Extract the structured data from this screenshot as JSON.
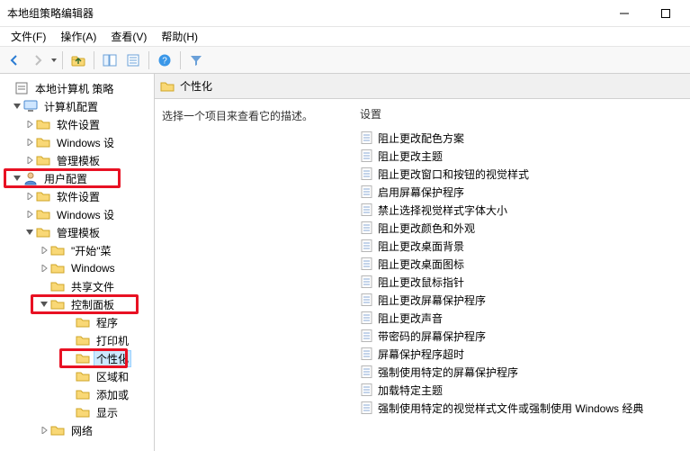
{
  "window": {
    "title": "本地组策略编辑器"
  },
  "menu": {
    "file": "文件(F)",
    "action": "操作(A)",
    "view": "查看(V)",
    "help": "帮助(H)"
  },
  "tree": {
    "root": "本地计算机 策略",
    "computer_cfg": "计算机配置",
    "comp_sw": "软件设置",
    "comp_win": "Windows 设",
    "comp_adm": "管理模板",
    "user_cfg": "用户配置",
    "user_sw": "软件设置",
    "user_win": "Windows 设",
    "user_adm": "管理模板",
    "start_menu": "\"开始\"菜",
    "windows": "Windows",
    "shared_folders": "共享文件",
    "control_panel": "控制面板",
    "programs": "程序",
    "printers": "打印机",
    "personalization": "个性化",
    "regional": "区域和",
    "add_remove": "添加或",
    "display": "显示",
    "network": "网络"
  },
  "content": {
    "header": "个性化",
    "desc": "选择一个项目来查看它的描述。",
    "settings_label": "设置",
    "items": [
      "阻止更改配色方案",
      "阻止更改主题",
      "阻止更改窗口和按钮的视觉样式",
      "启用屏幕保护程序",
      "禁止选择视觉样式字体大小",
      "阻止更改颜色和外观",
      "阻止更改桌面背景",
      "阻止更改桌面图标",
      "阻止更改鼠标指针",
      "阻止更改屏幕保护程序",
      "阻止更改声音",
      "带密码的屏幕保护程序",
      "屏幕保护程序超时",
      "强制使用特定的屏幕保护程序",
      "加载特定主题",
      "强制使用特定的视觉样式文件或强制使用 Windows 经典"
    ]
  }
}
